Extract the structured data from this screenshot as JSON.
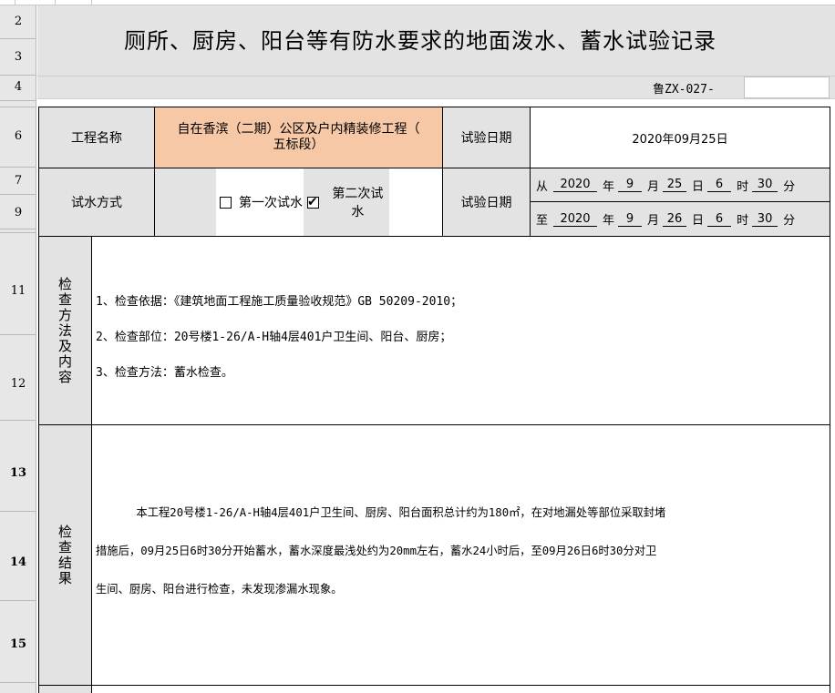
{
  "row_headers": [
    "2",
    "3",
    "4",
    "6",
    "7",
    "9",
    "11",
    "12",
    "13",
    "14",
    "15"
  ],
  "title": "厕所、厨房、阳台等有防水要求的地面泼水、蓄水试验记录",
  "code": "鲁ZX-027-",
  "project": {
    "label": "工程名称",
    "value": "自在香滨（二期）公区及户内精装修工程（五标段）",
    "value_line1": "自在香滨（二期）公区及户内精装修工程（",
    "value_line2": "五标段）",
    "highlight_color": "#f6c8a5"
  },
  "test_date": {
    "label": "试验日期",
    "value": "2020年09月25日"
  },
  "test_method": {
    "label": "试水方式",
    "options": [
      {
        "label": "第一次试水",
        "checked": false
      },
      {
        "label": "第二次试水",
        "checked": true
      }
    ]
  },
  "test_date_range": {
    "label": "试验日期",
    "from": {
      "prefix": "从",
      "year": "2020",
      "month": "9",
      "day": "25",
      "hour": "6",
      "minute": "30"
    },
    "to": {
      "prefix": "至",
      "year": "2020",
      "month": "9",
      "day": "26",
      "hour": "6",
      "minute": "30"
    },
    "units": {
      "year": "年",
      "month": "月",
      "day": "日",
      "hour": "时",
      "minute": "分"
    }
  },
  "inspection_method": {
    "label": "检查方法及内容",
    "lines": [
      "1、检查依据：《建筑地面工程施工质量验收规范》GB 50209-2010；",
      "2、检查部位：20号楼1-26/A-H轴4层401户卫生间、阳台、厨房；",
      "3、检查方法：蓄水检查。"
    ]
  },
  "inspection_result": {
    "label": "检查结果",
    "lines": [
      "      本工程20号楼1-26/A-H轴4层401户卫生间、厨房、阳台面积总计约为180㎡，在对地漏处等部位采取封堵",
      "措施后，09月25日6时30分开始蓄水，蓄水深度最浅处约为20mm左右，蓄水24小时后，至09月26日6时30分对卫",
      "生间、厨房、阳台进行检查，未发现渗漏水现象。"
    ]
  }
}
